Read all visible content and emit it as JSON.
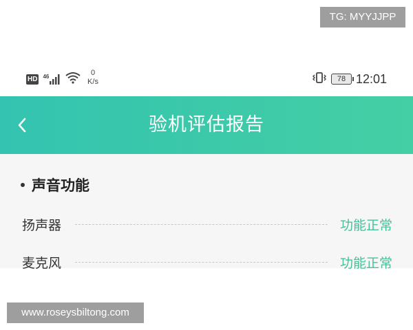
{
  "watermark_top": "TG: MYYJJPP",
  "watermark_bottom": "www.roseysbiltong.com",
  "status_bar": {
    "hd_label": "HD",
    "network_label": "46",
    "net_speed_value": "0",
    "net_speed_unit": "K/s",
    "battery_level": "78",
    "time": "12:01"
  },
  "header": {
    "title": "验机评估报告"
  },
  "section": {
    "title": "声音功能",
    "items": [
      {
        "label": "扬声器",
        "status": "功能正常"
      },
      {
        "label": "麦克风",
        "status": "功能正常"
      }
    ]
  },
  "colors": {
    "header_gradient_start": "#33c3b0",
    "header_gradient_end": "#45cfa4",
    "status_ok": "#45c19a"
  }
}
